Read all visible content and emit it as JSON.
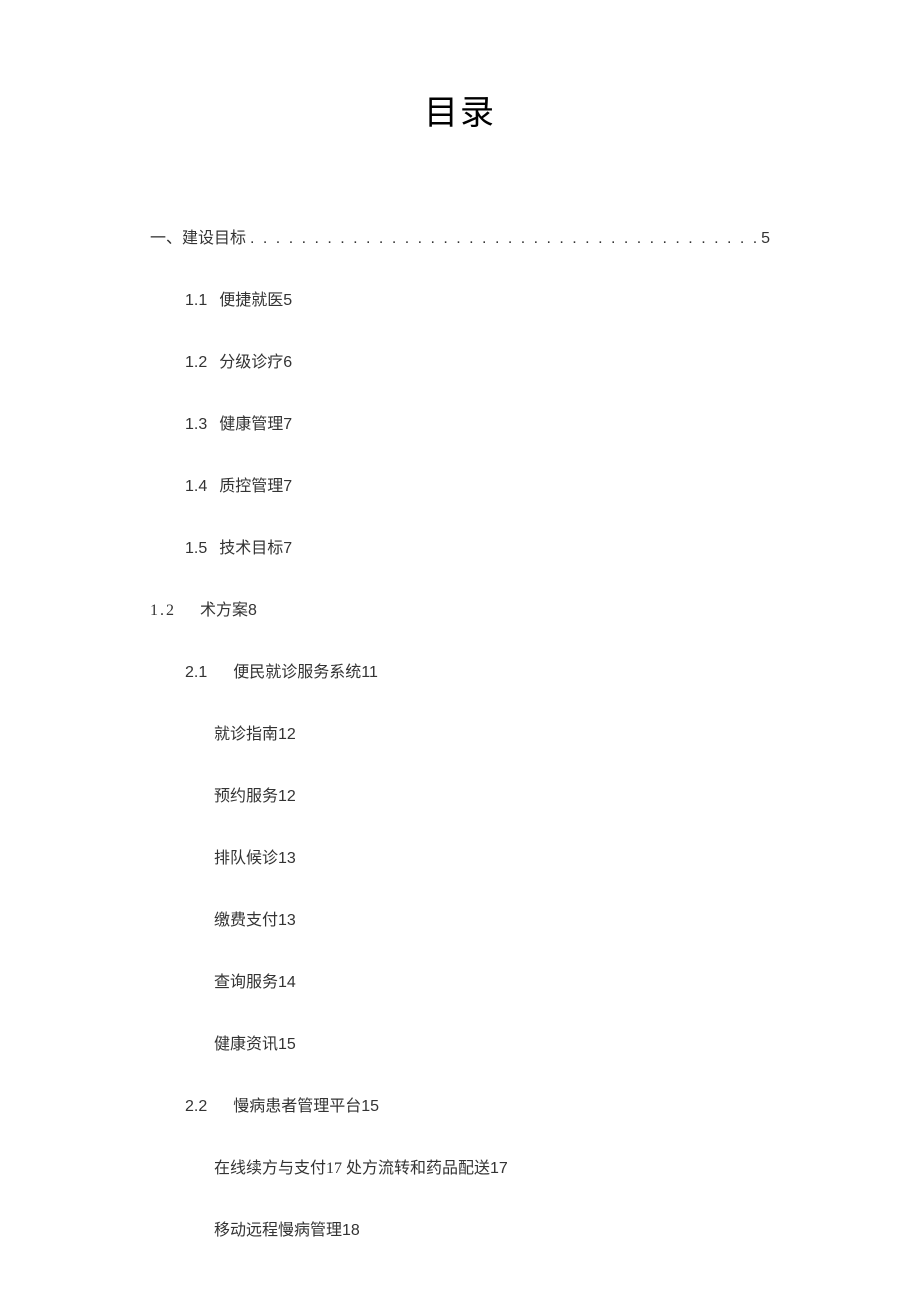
{
  "title": "目录",
  "dots": ". . . . . . . . . . . . . . . . . . . . . . . . . . . . . . . . . . . . . . . . . . . . . . . . . . . . . . . . . . . .",
  "section1": {
    "label": "一、建设目标",
    "page": "5",
    "items": [
      {
        "num": "1.1",
        "label": "便捷就医",
        "page": "5"
      },
      {
        "num": "1.2",
        "label": "分级诊疗",
        "page": "6"
      },
      {
        "num": "1.3",
        "label": "健康管理",
        "page": "7"
      },
      {
        "num": "1.4",
        "label": "质控管理",
        "page": "7"
      },
      {
        "num": "1.5",
        "label": "技术目标",
        "page": "7"
      }
    ]
  },
  "section2": {
    "num": "1.2",
    "label": "术方案",
    "page": "8",
    "sub1": {
      "num": "2.1",
      "label": "便民就诊服务系统",
      "page": "11",
      "items": [
        {
          "label": "就诊指南",
          "page": "12"
        },
        {
          "label": "预约服务",
          "page": "12"
        },
        {
          "label": "排队候诊",
          "page": "13"
        },
        {
          "label": "缴费支付",
          "page": "13"
        },
        {
          "label": "查询服务",
          "page": "14"
        },
        {
          "label": "健康资讯",
          "page": "15"
        }
      ]
    },
    "sub2": {
      "num": "2.2",
      "label": "慢病患者管理平台",
      "page": "15",
      "items": [
        {
          "label": "在线续方与支付17 处方流转和药品配送",
          "page": "17"
        },
        {
          "label": "移动远程慢病管理",
          "page": "18"
        }
      ]
    }
  }
}
